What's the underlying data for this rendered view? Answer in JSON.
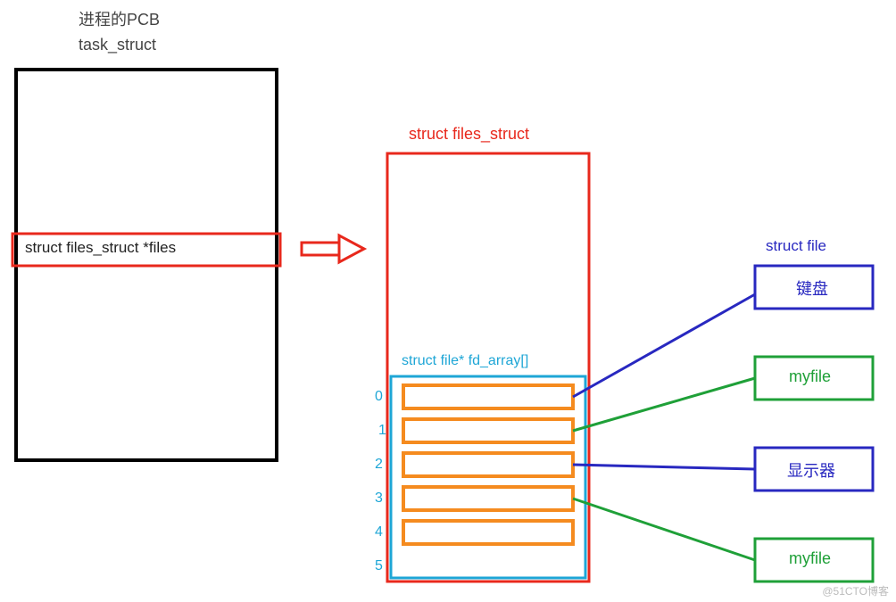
{
  "titles": {
    "pcb_title": "进程的PCB",
    "task_struct": "task_struct",
    "files_struct": "struct files_struct",
    "fd_array_label": "struct file* fd_array[]",
    "struct_file_label": "struct file"
  },
  "pcb": {
    "member_files_ptr": "struct files_struct *files"
  },
  "fd_array": {
    "indices": [
      "0",
      "1",
      "2",
      "3",
      "4",
      "5"
    ]
  },
  "files": [
    {
      "label": "键盘",
      "color": "#2828c0"
    },
    {
      "label": "myfile",
      "color": "#1fa038"
    },
    {
      "label": "显示器",
      "color": "#2828c0"
    },
    {
      "label": "myfile",
      "color": "#1fa038"
    }
  ],
  "colors": {
    "black": "#000000",
    "red": "#e8281c",
    "cyan": "#1ea6d6",
    "orange": "#f58b1f",
    "blue": "#2828c0",
    "green": "#1fa038"
  },
  "watermark": "@51CTO博客"
}
